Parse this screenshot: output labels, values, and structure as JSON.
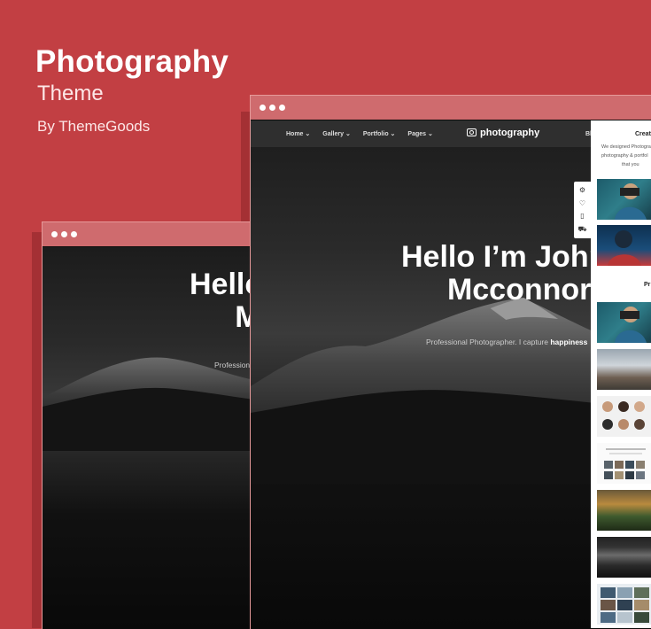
{
  "hero": {
    "title": "Photography",
    "subtitle": "Theme",
    "byline": "By ThemeGoods"
  },
  "colors": {
    "background": "#c23f43",
    "titlebar": "#cf6b6e",
    "panel": "#ffffff"
  },
  "back_window": {
    "hello_line1": "Hello I'm John",
    "hello_line2": "Mcconnor",
    "tagline_prefix": "Professional Photographer. I capture ",
    "tagline_bold": "happiness"
  },
  "front_window": {
    "nav": [
      {
        "label": "Home ⌄"
      },
      {
        "label": "Gallery ⌄"
      },
      {
        "label": "Portfolio ⌄"
      },
      {
        "label": "Pages ⌄"
      }
    ],
    "logo": "photography",
    "nav_right_partial": "Bl",
    "hello_line1": "Hello I’m John",
    "hello_line2": "Mcconnor",
    "tagline_prefix": "Professional Photographer. I capture ",
    "tagline_bold": "happiness",
    "side_tools": [
      "gear-icon",
      "heart-icon",
      "book-icon",
      "cart-icon"
    ]
  },
  "panel": {
    "heading": "Creat",
    "text_lines": [
      "We designed Photogra",
      "photography & portfol",
      "that you"
    ],
    "subheading": "Pr"
  }
}
